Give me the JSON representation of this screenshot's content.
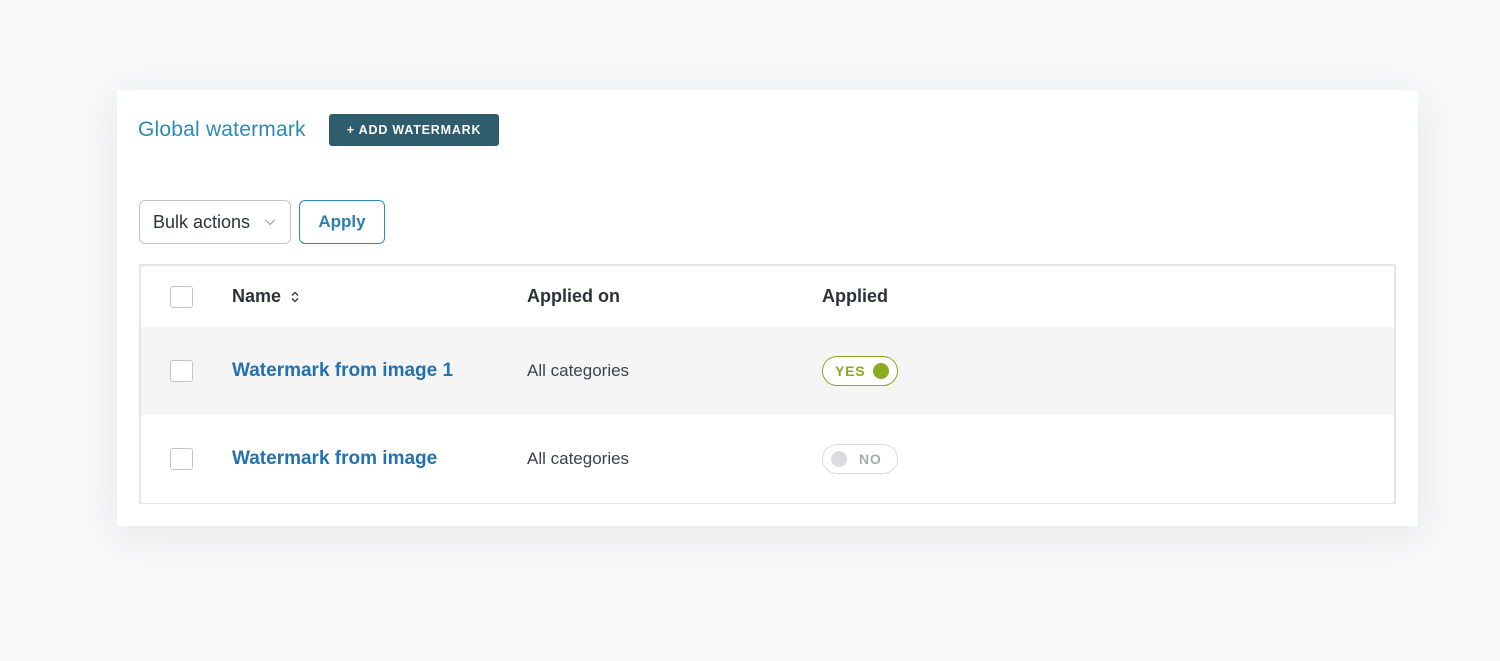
{
  "header": {
    "title": "Global watermark",
    "add_button_label": "+ ADD WATERMARK"
  },
  "bulk": {
    "select_value": "Bulk actions",
    "apply_label": "Apply"
  },
  "table": {
    "columns": [
      "Name",
      "Applied on",
      "Applied"
    ],
    "rows": [
      {
        "name": "Watermark from image 1",
        "applied_on": "All categories",
        "applied": "YES",
        "applied_state": true
      },
      {
        "name": "Watermark from image",
        "applied_on": "All categories",
        "applied": "NO",
        "applied_state": false
      }
    ]
  },
  "colors": {
    "accent": "#2b8bb8",
    "link": "#2271b1",
    "button_dark": "#2f5d6e",
    "toggle_on": "#8aaa22",
    "toggle_off": "#dcdcde"
  },
  "icons": {
    "sort": "sort-icon",
    "chevron": "chevron-down-icon"
  }
}
